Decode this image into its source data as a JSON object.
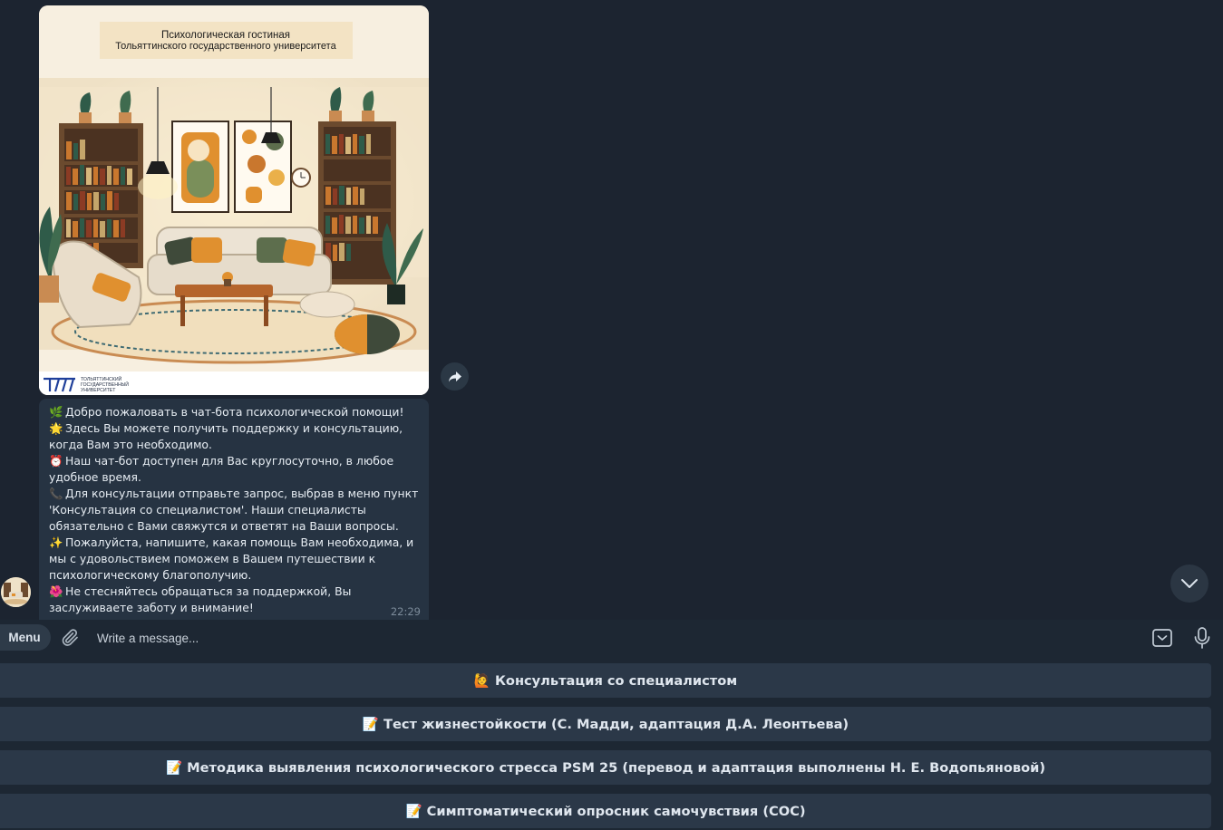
{
  "photo": {
    "banner_line1": "Психологическая гостиная",
    "banner_line2": "Тольяттинского государственного университета",
    "logo_line1": "ТОЛЬЯТТИНСКИЙ",
    "logo_line2": "ГОСУДАРСТВЕННЫЙ",
    "logo_line3": "УНИВЕРСИТЕТ"
  },
  "message": {
    "lines": [
      {
        "emoji": "🌿",
        "text": "Добро пожаловать в чат-бота психологической помощи!"
      },
      {
        "emoji": "🌟",
        "text": "Здесь Вы можете получить поддержку и консультацию, когда Вам это необходимо."
      },
      {
        "emoji": "⏰",
        "text": "Наш чат-бот доступен для Вас круглосуточно, в любое удобное время."
      },
      {
        "emoji": "📞",
        "text": "Для консультации отправьте запрос, выбрав в меню пункт 'Консультация со специалистом'. Наши специалисты обязательно с Вами свяжутся и ответят на Ваши вопросы."
      },
      {
        "emoji": "✨",
        "text": "Пожалуйста, напишите, какая помощь Вам необходима, и мы с удовольствием поможем в Вашем путешествии к психологическому благополучию."
      },
      {
        "emoji": "🌺",
        "text": "Не стесняйтесь обращаться за поддержкой, Вы заслуживаете заботу и внимание!"
      }
    ],
    "time": "22:29"
  },
  "composer": {
    "menu_label": "Menu",
    "placeholder": "Write a message..."
  },
  "keyboard": {
    "buttons": [
      {
        "emoji": "🙋",
        "label": "Консультация со специалистом"
      },
      {
        "emoji": "📝",
        "label": "Тест жизнестойкости (С. Мадди, адаптация Д.А. Леонтьева)"
      },
      {
        "emoji": "📝",
        "label": "Методика выявления психологического стресса PSM 25 (перевод и адаптация выполнены Н. Е. Водопьяновой)"
      },
      {
        "emoji": "📝",
        "label": "Симптоматический опросник самочувствия (СОС)"
      }
    ]
  },
  "colors": {
    "background": "#1c2430",
    "bubble": "#263342",
    "keyboard_button": "#2b3848",
    "menu_button": "#2e3b49",
    "timestamp": "#7c8b9a"
  },
  "icons": [
    "forward-icon",
    "chevron-down-icon",
    "paperclip-icon",
    "bot-keyboard-icon",
    "microphone-icon"
  ]
}
